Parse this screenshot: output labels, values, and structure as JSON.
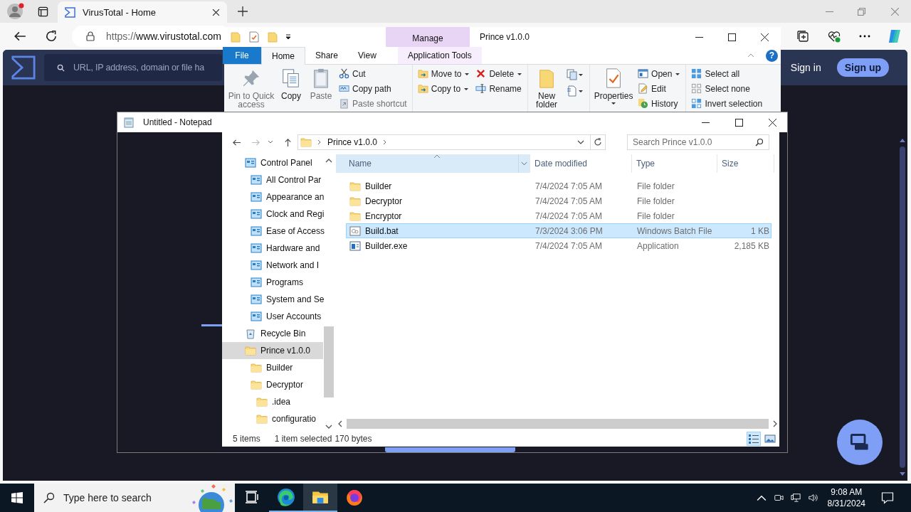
{
  "browser": {
    "tabs": [
      {
        "title": "VirusTotal - Home",
        "selected": true
      }
    ],
    "url_scheme": "https://",
    "url_host": "www.virustotal.com",
    "page": {
      "search_placeholder": "URL, IP address, domain or file ha",
      "sign_in": "Sign in",
      "sign_up": "Sign up"
    }
  },
  "explorer": {
    "title": "Prince v1.0.0",
    "context_tab": "Manage",
    "ribbon_tabs": [
      {
        "label": "File",
        "kind": "file",
        "selected": false
      },
      {
        "label": "Home",
        "kind": "tab",
        "selected": true
      },
      {
        "label": "Share",
        "kind": "tab",
        "selected": false
      },
      {
        "label": "View",
        "kind": "tab",
        "selected": false
      },
      {
        "label": "Application Tools",
        "kind": "context",
        "selected": false
      }
    ],
    "ribbon": {
      "pin": {
        "label": "Pin to Quick access",
        "disabled": true
      },
      "copy": {
        "label": "Copy",
        "disabled": false
      },
      "paste": {
        "label": "Paste",
        "disabled": true
      },
      "cut": {
        "label": "Cut",
        "disabled": false
      },
      "copy_path": {
        "label": "Copy path",
        "disabled": false
      },
      "paste_shortcut": {
        "label": "Paste shortcut",
        "disabled": true
      },
      "move_to": {
        "label": "Move to",
        "disabled": false
      },
      "copy_to": {
        "label": "Copy to",
        "disabled": false
      },
      "delete": {
        "label": "Delete",
        "disabled": false
      },
      "rename": {
        "label": "Rename",
        "disabled": false
      },
      "new_folder": {
        "label": "New folder",
        "disabled": false
      },
      "properties": {
        "label": "Properties",
        "disabled": false
      },
      "open": {
        "label": "Open",
        "disabled": false
      },
      "edit": {
        "label": "Edit",
        "disabled": false
      },
      "history": {
        "label": "History",
        "disabled": false
      },
      "select_all": {
        "label": "Select all",
        "disabled": false
      },
      "select_none": {
        "label": "Select none",
        "disabled": false
      },
      "invert_selection": {
        "label": "Invert selection",
        "disabled": false
      }
    },
    "help": "?",
    "address": "Prince v1.0.0",
    "search_placeholder": "Search Prince v1.0.0",
    "nav": [
      {
        "label": "Control Panel",
        "kind": "control-panel",
        "selected": false,
        "children": [
          {
            "label": "All Control Par",
            "kind": "control-panel",
            "selected": false
          },
          {
            "label": "Appearance an",
            "kind": "control-panel",
            "selected": false
          },
          {
            "label": "Clock and Regi",
            "kind": "control-panel",
            "selected": false
          },
          {
            "label": "Ease of Access",
            "kind": "control-panel",
            "selected": false
          },
          {
            "label": "Hardware and",
            "kind": "control-panel",
            "selected": false
          },
          {
            "label": "Network and I",
            "kind": "control-panel",
            "selected": false
          },
          {
            "label": "Programs",
            "kind": "control-panel",
            "selected": false
          },
          {
            "label": "System and Se",
            "kind": "control-panel",
            "selected": false
          },
          {
            "label": "User Accounts",
            "kind": "control-panel",
            "selected": false
          }
        ]
      },
      {
        "label": "Recycle Bin",
        "kind": "recycle-bin",
        "selected": false
      },
      {
        "label": "Prince v1.0.0",
        "kind": "folder",
        "selected": true,
        "children": [
          {
            "label": "Builder",
            "kind": "folder",
            "selected": false
          },
          {
            "label": "Decryptor",
            "kind": "folder",
            "selected": false,
            "children": [
              {
                "label": ".idea",
                "kind": "folder",
                "selected": false
              },
              {
                "label": "configuratio",
                "kind": "folder",
                "selected": false
              }
            ]
          }
        ]
      }
    ],
    "columns": [
      {
        "label": "Name",
        "selected": true
      },
      {
        "label": "Date modified",
        "selected": false
      },
      {
        "label": "Type",
        "selected": false
      },
      {
        "label": "Size",
        "selected": false
      }
    ],
    "rows": [
      {
        "name": "Builder",
        "kind": "folder",
        "date": "7/4/2024 7:05 AM",
        "type": "File folder",
        "selected": false
      },
      {
        "name": "Decryptor",
        "kind": "folder",
        "date": "7/4/2024 7:05 AM",
        "type": "File folder",
        "selected": false
      },
      {
        "name": "Encryptor",
        "kind": "folder",
        "date": "7/4/2024 7:05 AM",
        "type": "File folder",
        "selected": false
      },
      {
        "name": "Build.bat",
        "kind": "batch",
        "date": "7/3/2024 3:06 PM",
        "type": "Windows Batch File",
        "size": "1 KB",
        "selected": true
      },
      {
        "name": "Builder.exe",
        "kind": "application",
        "date": "7/4/2024 7:05 AM",
        "type": "Application",
        "size": "2,185 KB",
        "selected": false
      }
    ],
    "status": {
      "count": "5 items",
      "selection": "1 item selected",
      "size": "170 bytes"
    },
    "views": [
      {
        "kind": "details",
        "selected": true
      },
      {
        "kind": "large-icons",
        "selected": false
      }
    ]
  },
  "notepad": {
    "title": "Untitled - Notepad"
  },
  "taskbar": {
    "search_placeholder": "Type here to search",
    "apps": [
      {
        "kind": "task-view",
        "running": false,
        "selected": false
      },
      {
        "kind": "edge",
        "running": true,
        "selected": false
      },
      {
        "kind": "explorer",
        "running": true,
        "selected": true
      },
      {
        "kind": "firefox",
        "running": false,
        "selected": false
      }
    ],
    "time": "9:08 AM",
    "date": "8/31/2024"
  }
}
